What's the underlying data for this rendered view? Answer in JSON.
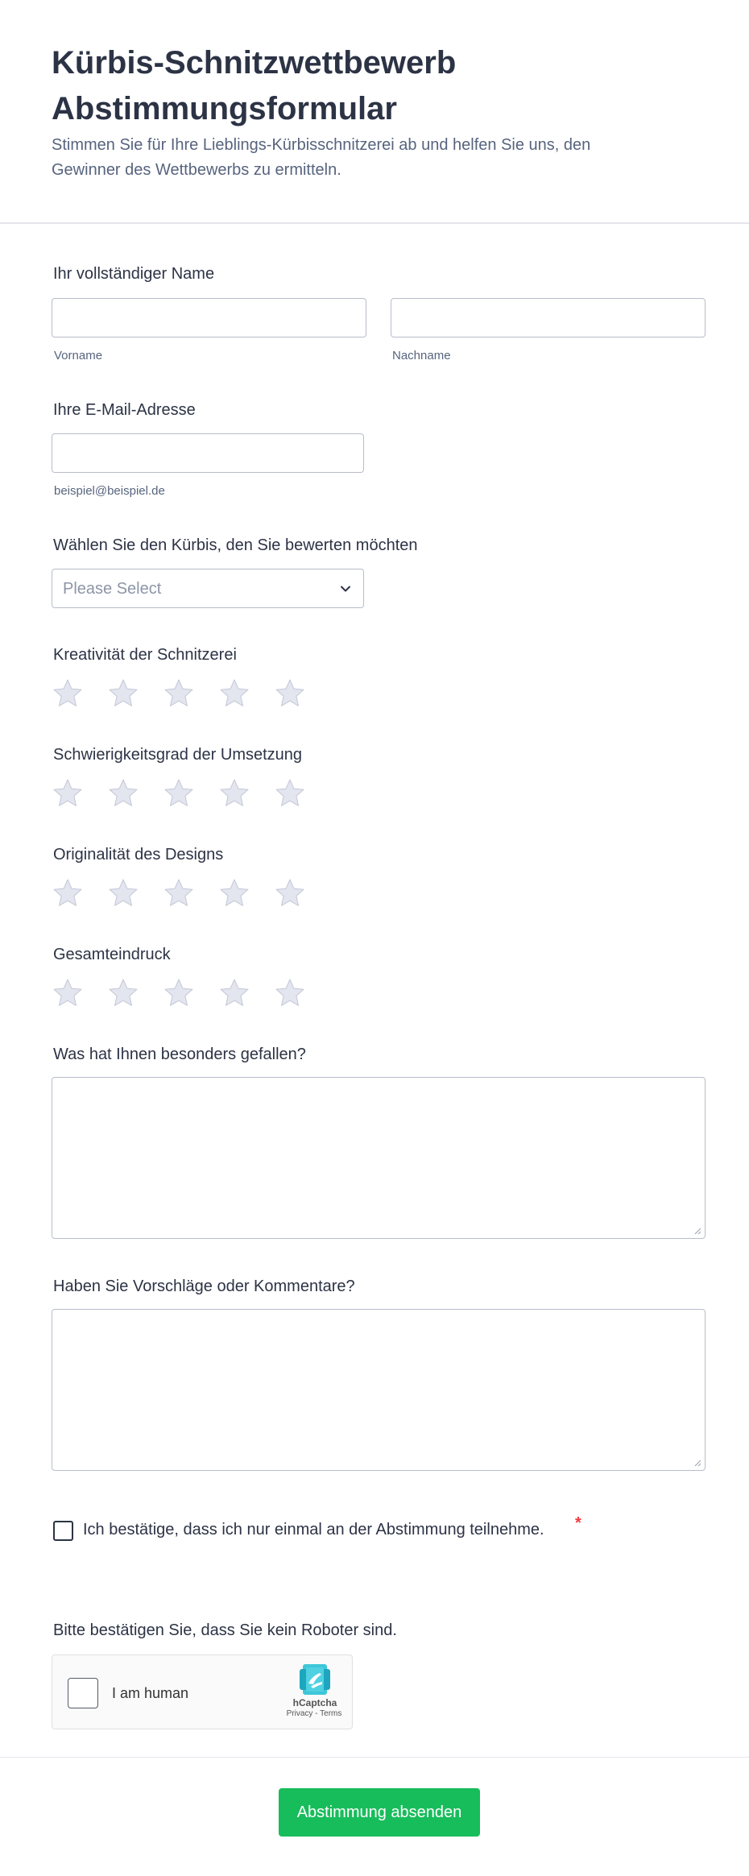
{
  "header": {
    "title": "Kürbis-Schnitzwettbewerb Abstimmungsformular",
    "subtitle": "Stimmen Sie für Ihre Lieblings-Kürbisschnitzerei ab und helfen Sie uns, den Gewinner des Wettbewerbs zu ermitteln."
  },
  "name": {
    "label": "Ihr vollständiger Name",
    "first_value": "",
    "first_sublabel": "Vorname",
    "last_value": "",
    "last_sublabel": "Nachname"
  },
  "email": {
    "label": "Ihre E-Mail-Adresse",
    "value": "",
    "sublabel": "beispiel@beispiel.de"
  },
  "pumpkin": {
    "label": "Wählen Sie den Kürbis, den Sie bewerten möchten",
    "selected": "Please Select"
  },
  "ratings": [
    {
      "label": "Kreativität der Schnitzerei",
      "value": 0,
      "max": 5
    },
    {
      "label": "Schwierigkeitsgrad der Umsetzung",
      "value": 0,
      "max": 5
    },
    {
      "label": "Originalität des Designs",
      "value": 0,
      "max": 5
    },
    {
      "label": "Gesamteindruck",
      "value": 0,
      "max": 5
    }
  ],
  "liked": {
    "label": "Was hat Ihnen besonders gefallen?",
    "value": ""
  },
  "comments": {
    "label": "Haben Sie Vorschläge oder Kommentare?",
    "value": ""
  },
  "confirm": {
    "text": "Ich bestätige, dass ich nur einmal an der Abstimmung teilnehme.",
    "required_mark": "*",
    "checked": false
  },
  "captcha": {
    "label": "Bitte bestätigen Sie, dass Sie kein Roboter sind.",
    "checkbox_text": "I am human",
    "brand": "hCaptcha",
    "links": "Privacy - Terms"
  },
  "submit": {
    "label": "Abstimmung absenden"
  },
  "colors": {
    "accent": "#18bd5b",
    "star_empty": "#e3e5ef",
    "star_stroke": "#c3c8d6",
    "required": "#f23a3c"
  },
  "icons": {
    "select": "chevron-down-icon",
    "rating": "star-icon",
    "captcha": "hcaptcha-logo-icon"
  }
}
